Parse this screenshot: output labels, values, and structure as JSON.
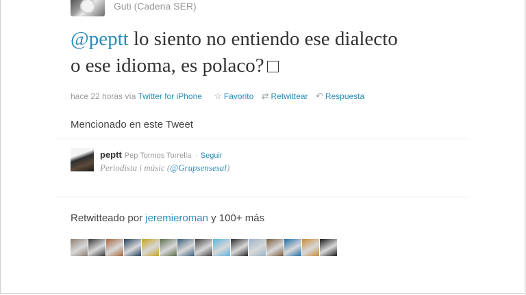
{
  "tweet": {
    "author": "Guti (Cadena SER)",
    "mention": "@peptt",
    "text_line1": " lo siento no entiendo ese dialecto",
    "text_line2": "o ese idioma, es polaco?",
    "time": "hace 22 horas",
    "via": "vía",
    "source": "Twitter for iPhone",
    "actions": {
      "favorite": "Favorito",
      "retweet": "Retwittear",
      "reply": "Respuesta"
    }
  },
  "mentioned": {
    "heading": "Mencionado en este Tweet",
    "handle": "peptt",
    "fullname": "Pep Tormos Torrella",
    "separator": "·",
    "follow": "Seguir",
    "bio_prefix": "Periodista i músic (",
    "bio_link": "@Grupsensesal",
    "bio_suffix": ")"
  },
  "retweeted": {
    "prefix": "Retwitteado por ",
    "user": "jeremieroman",
    "suffix": " y 100+ más",
    "avatar_colors": [
      "#8c7f73",
      "#3a3a3a",
      "#a8663c",
      "#24425e",
      "#c7a31c",
      "#5d6e4c",
      "#3c5f7d",
      "#444444",
      "#5bb4e0",
      "#2b2b2b",
      "#9ab3c9",
      "#7a5a3e",
      "#1f6fa8",
      "#c98a3a",
      "#1a1a1a"
    ]
  }
}
